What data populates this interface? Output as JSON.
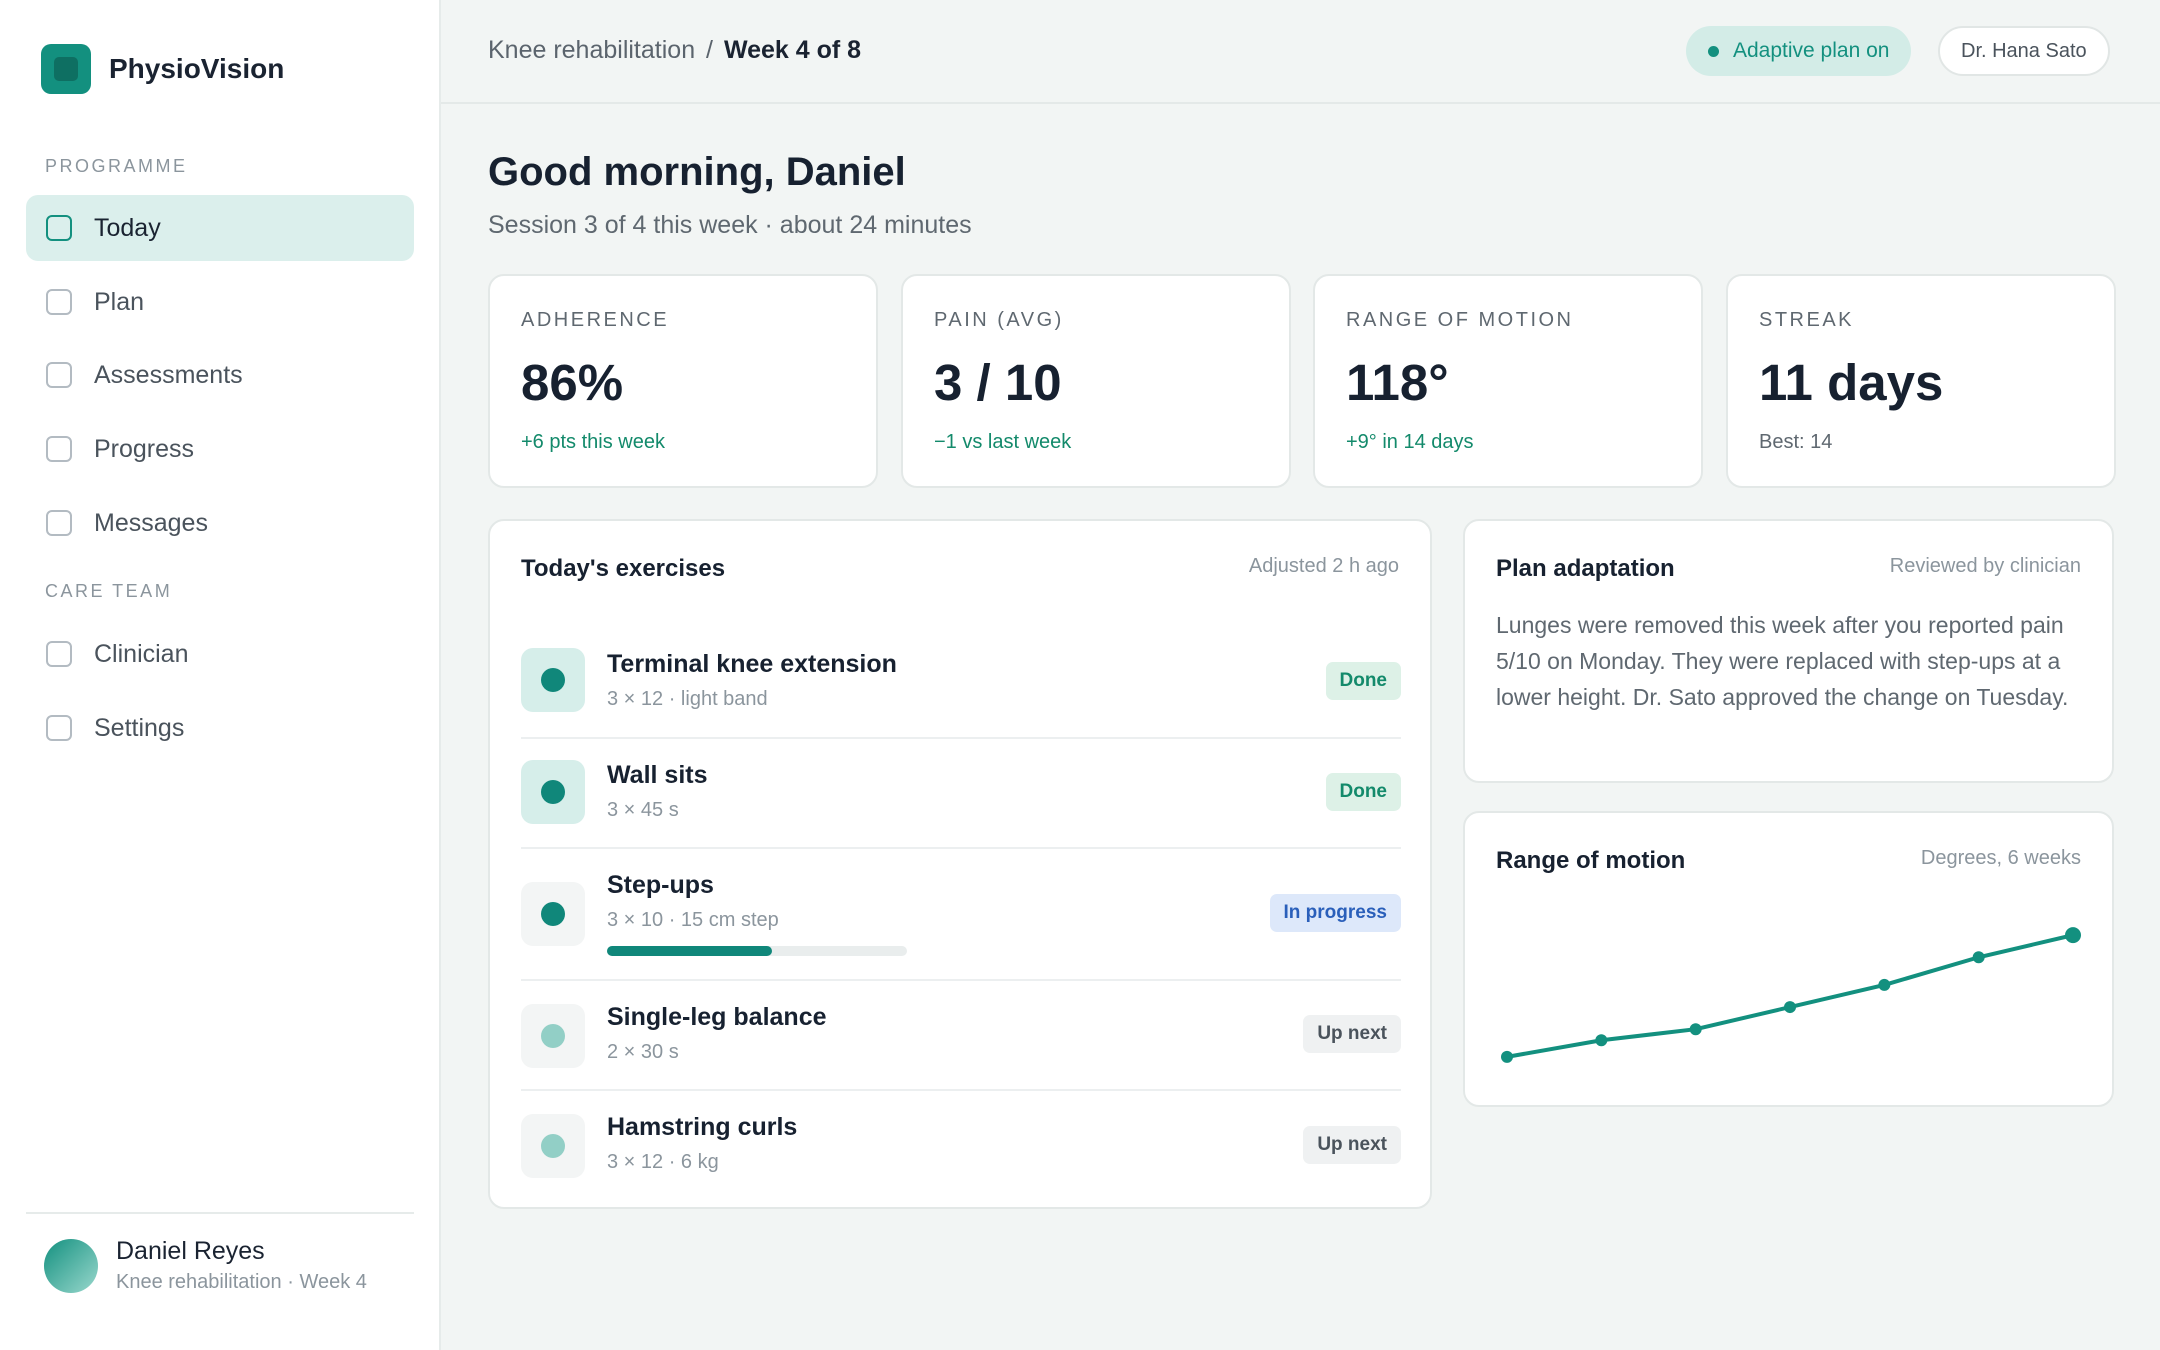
{
  "app": {
    "name": "PhysioVision"
  },
  "sidebar": {
    "section_programme": "PROGRAMME",
    "programme_items": [
      {
        "label": "Today",
        "active": true
      },
      {
        "label": "Plan",
        "active": false
      },
      {
        "label": "Assessments",
        "active": false
      },
      {
        "label": "Progress",
        "active": false
      },
      {
        "label": "Messages",
        "active": false
      }
    ],
    "section_care": "CARE TEAM",
    "care_items": [
      {
        "label": "Clinician"
      },
      {
        "label": "Settings"
      }
    ],
    "user": {
      "name": "Daniel Reyes",
      "subtitle": "Knee rehabilitation · Week 4"
    }
  },
  "topbar": {
    "breadcrumb_parent": "Knee rehabilitation",
    "breadcrumb_sep": "/",
    "breadcrumb_current": "Week 4 of 8",
    "adaptive_label": "Adaptive plan on",
    "clinician_label": "Dr. Hana Sato"
  },
  "header": {
    "greeting": "Good morning, Daniel",
    "subtitle": "Session 3 of 4 this week · about 24 minutes"
  },
  "stats": [
    {
      "label": "ADHERENCE",
      "value": "86%",
      "note": "+6 pts this week",
      "tone": "green"
    },
    {
      "label": "PAIN (AVG)",
      "value": "3 / 10",
      "note": "−1 vs last week",
      "tone": "green"
    },
    {
      "label": "RANGE OF MOTION",
      "value": "118°",
      "note": "+9° in 14 days",
      "tone": "green"
    },
    {
      "label": "STREAK",
      "value": "11 days",
      "note": "Best: 14",
      "tone": "muted"
    }
  ],
  "exercises": {
    "title": "Today's exercises",
    "meta": "Adjusted 2 h ago",
    "items": [
      {
        "name": "Terminal knee extension",
        "detail": "3 × 12 · light band",
        "status": "Done",
        "state": "done"
      },
      {
        "name": "Wall sits",
        "detail": "3 × 45 s",
        "status": "Done",
        "state": "done"
      },
      {
        "name": "Step-ups",
        "detail": "3 × 10 · 15 cm step",
        "status": "In progress",
        "state": "progress",
        "progress": 0.55
      },
      {
        "name": "Single-leg balance",
        "detail": "2 × 30 s",
        "status": "Up next",
        "state": "next"
      },
      {
        "name": "Hamstring curls",
        "detail": "3 × 12 · 6 kg",
        "status": "Up next",
        "state": "next"
      }
    ]
  },
  "adaptation": {
    "title": "Plan adaptation",
    "meta": "Reviewed by clinician",
    "body": "Lunges were removed this week after you reported pain 5/10 on Monday. They were replaced with step-ups at a lower height. Dr. Sato approved the change on Tuesday."
  },
  "rom_chart": {
    "title": "Range of motion",
    "meta": "Degrees, 6 weeks",
    "color": "#13907f"
  },
  "chart_data": {
    "type": "line",
    "title": "Range of motion",
    "subtitle": "Degrees, 6 weeks",
    "series": [
      {
        "values": [
          96,
          99,
          101,
          105,
          109,
          114,
          118
        ]
      }
    ],
    "ylim": [
      92,
      122
    ],
    "grid": false
  }
}
